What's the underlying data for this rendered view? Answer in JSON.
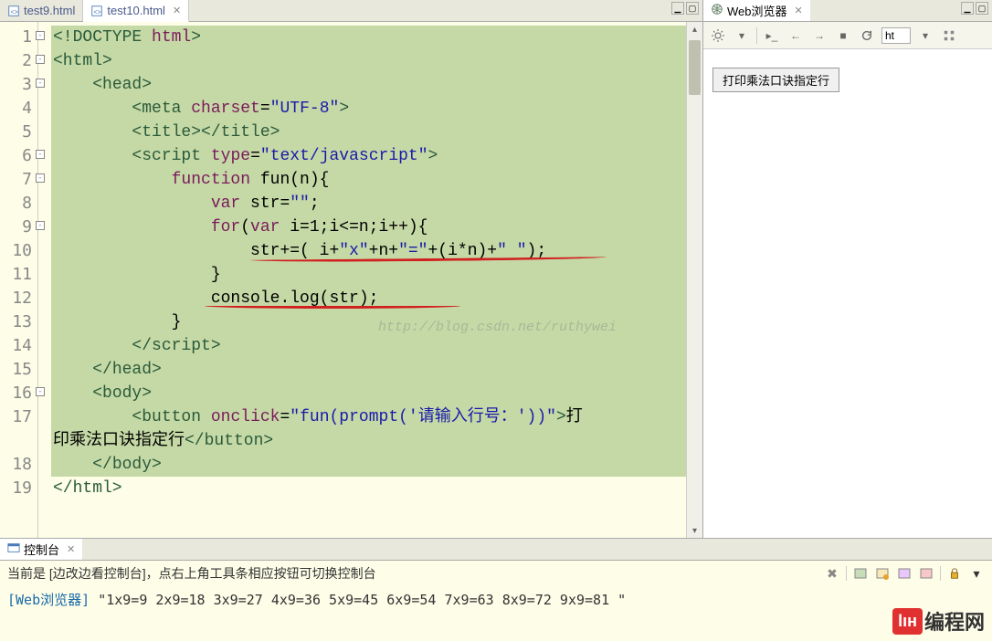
{
  "editor": {
    "tabs": [
      {
        "label": "test9.html",
        "active": false
      },
      {
        "label": "test10.html",
        "active": true
      }
    ],
    "lines": [
      {
        "n": "1",
        "fold": "-",
        "html": "<span class='tag'>&lt;!DOCTYPE</span> <span class='attr'>html</span><span class='tag'>&gt;</span>"
      },
      {
        "n": "2",
        "fold": "-",
        "html": "<span class='tag'>&lt;html&gt;</span>"
      },
      {
        "n": "3",
        "fold": "-",
        "html": "    <span class='tag'>&lt;head&gt;</span>"
      },
      {
        "n": "4",
        "fold": "",
        "html": "        <span class='tag'>&lt;meta</span> <span class='attr'>charset</span>=<span class='val'>\"UTF-8\"</span><span class='tag'>&gt;</span>"
      },
      {
        "n": "5",
        "fold": "",
        "html": "        <span class='tag'>&lt;title&gt;&lt;/title&gt;</span>"
      },
      {
        "n": "6",
        "fold": "-",
        "html": "        <span class='tag'>&lt;script</span> <span class='attr'>type</span>=<span class='val'>\"text/javascript\"</span><span class='tag'>&gt;</span>"
      },
      {
        "n": "7",
        "fold": "-",
        "html": "            <span class='kw'>function</span> fun(n){"
      },
      {
        "n": "8",
        "fold": "",
        "html": "                <span class='kw'>var</span> str=<span class='str'>\"\"</span>;"
      },
      {
        "n": "9",
        "fold": "-",
        "html": "                <span class='kw'>for</span>(<span class='kw'>var</span> i=1;i&lt;=n;i++){"
      },
      {
        "n": "10",
        "fold": "",
        "html": "                    str+=( i+<span class='str'>\"x\"</span>+n+<span class='str'>\"=\"</span>+(i*n)+<span class='str'>\" \"</span>);"
      },
      {
        "n": "11",
        "fold": "",
        "html": "                }"
      },
      {
        "n": "12",
        "fold": "",
        "html": "                console.log(str);"
      },
      {
        "n": "13",
        "fold": "",
        "html": "            }"
      },
      {
        "n": "14",
        "fold": "",
        "html": "        <span class='tag'>&lt;/script&gt;</span>"
      },
      {
        "n": "15",
        "fold": "",
        "html": "    <span class='tag'>&lt;/head&gt;</span>"
      },
      {
        "n": "16",
        "fold": "-",
        "html": "    <span class='tag'>&lt;body&gt;</span>"
      },
      {
        "n": "17",
        "fold": "",
        "html": "        <span class='tag'>&lt;button</span> <span class='attr'>onclick</span>=<span class='val'>\"fun(prompt('请输入行号：'))\"</span><span class='tag'>&gt;</span>打"
      },
      {
        "n": "",
        "fold": "",
        "html": "印乘法口诀指定行<span class='tag'>&lt;/button&gt;</span>"
      },
      {
        "n": "18",
        "fold": "",
        "html": "    <span class='tag'>&lt;/body&gt;</span>"
      },
      {
        "n": "19",
        "fold": "",
        "html": "<span class='tag'>&lt;/html&gt;</span>",
        "nohl": true
      }
    ],
    "watermark": "http://blog.csdn.net/ruthywei"
  },
  "browser": {
    "tab_label": "Web浏览器",
    "url_value": "ht",
    "button_label": "打印乘法口诀指定行"
  },
  "console": {
    "tab_label": "控制台",
    "status_text": "当前是 [边改边看控制台]，点右上角工具条相应按钮可切换控制台",
    "output_source": "[Web浏览器]",
    "output_text": "\"1x9=9 2x9=18 3x9=27 4x9=36 5x9=45 6x9=54 7x9=63 8x9=72 9x9=81 \""
  },
  "brand": {
    "badge": "lıн",
    "text": "编程网"
  }
}
